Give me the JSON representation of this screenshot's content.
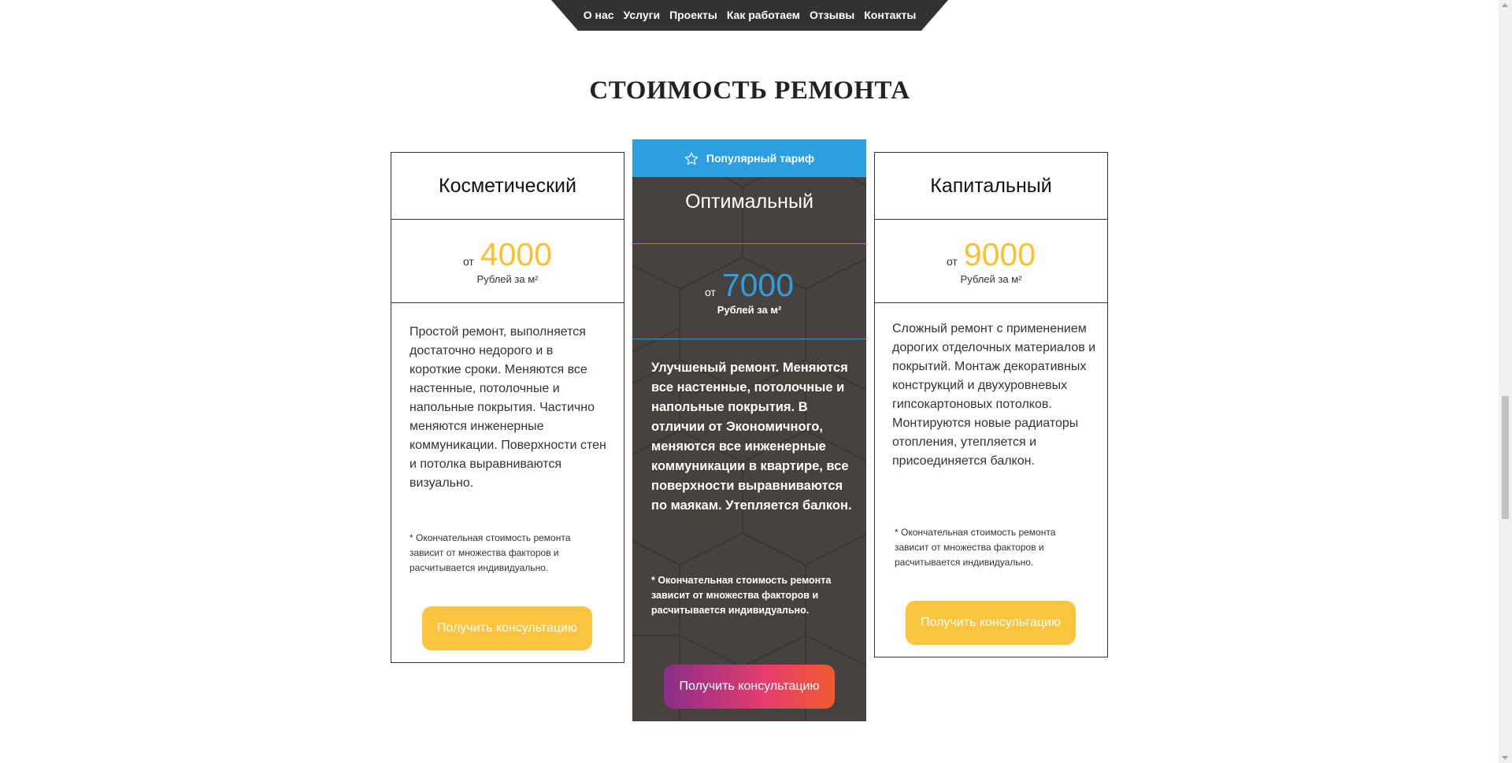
{
  "nav": {
    "items": [
      "О нас",
      "Услуги",
      "Проекты",
      "Как работаем",
      "Отзывы",
      "Контакты"
    ]
  },
  "section": {
    "title": "СТОИМОСТЬ РЕМОНТА"
  },
  "plans": [
    {
      "title": "Косметический",
      "price_from": "от",
      "price": "4000",
      "unit": "Рублей за м²",
      "description": "Простой ремонт, выполняется достаточно недорого и в короткие сроки. Меняются все настенные, потолочные и напольные покрытия. Частично меняются инженерные коммуникации. Поверхности стен и потолка выравниваются визуально.",
      "note": "* Окончательная стоимость ремонта зависит от множества факторов и расчитывается индивидуально.",
      "button": "Получить консультацию"
    },
    {
      "badge": "Популярный тариф",
      "title": "Оптимальный",
      "price_from": "от",
      "price": "7000",
      "unit": "Рублей за м²",
      "description": "Улучшеный ремонт. Меняются все настенные, потолочные и напольные покрытия. В отличии от Экономичного, меняются все инженерные коммуникации в квартире, все поверхности выравниваются по маякам. Утепляется балкон.",
      "note": "* Окончательная стоимость ремонта зависит от множества факторов и расчитывается индивидуально.",
      "button": "Получить консультацию"
    },
    {
      "title": "Капитальный",
      "price_from": "от",
      "price": "9000",
      "unit": "Рублей за м²",
      "description": "Сложный ремонт с применением дорогих отделочных материалов и покрытий. Монтаж декоративных конструкций и двухуровневых гипсокартоновых потолков. Монтируются новые радиаторы отопления, утепляется и присоединяется балкон.",
      "note": "* Окончательная стоимость ремонта зависит от множества факторов и расчитывается индивидуально.",
      "button": "Получить консультацию"
    }
  ],
  "colors": {
    "accent_yellow": "#fbc43c",
    "accent_blue": "#2d9ee0",
    "dark_card": "#47423f",
    "nav_bg": "#333131"
  },
  "icons": {
    "badge_icon": "star-outline-icon"
  }
}
